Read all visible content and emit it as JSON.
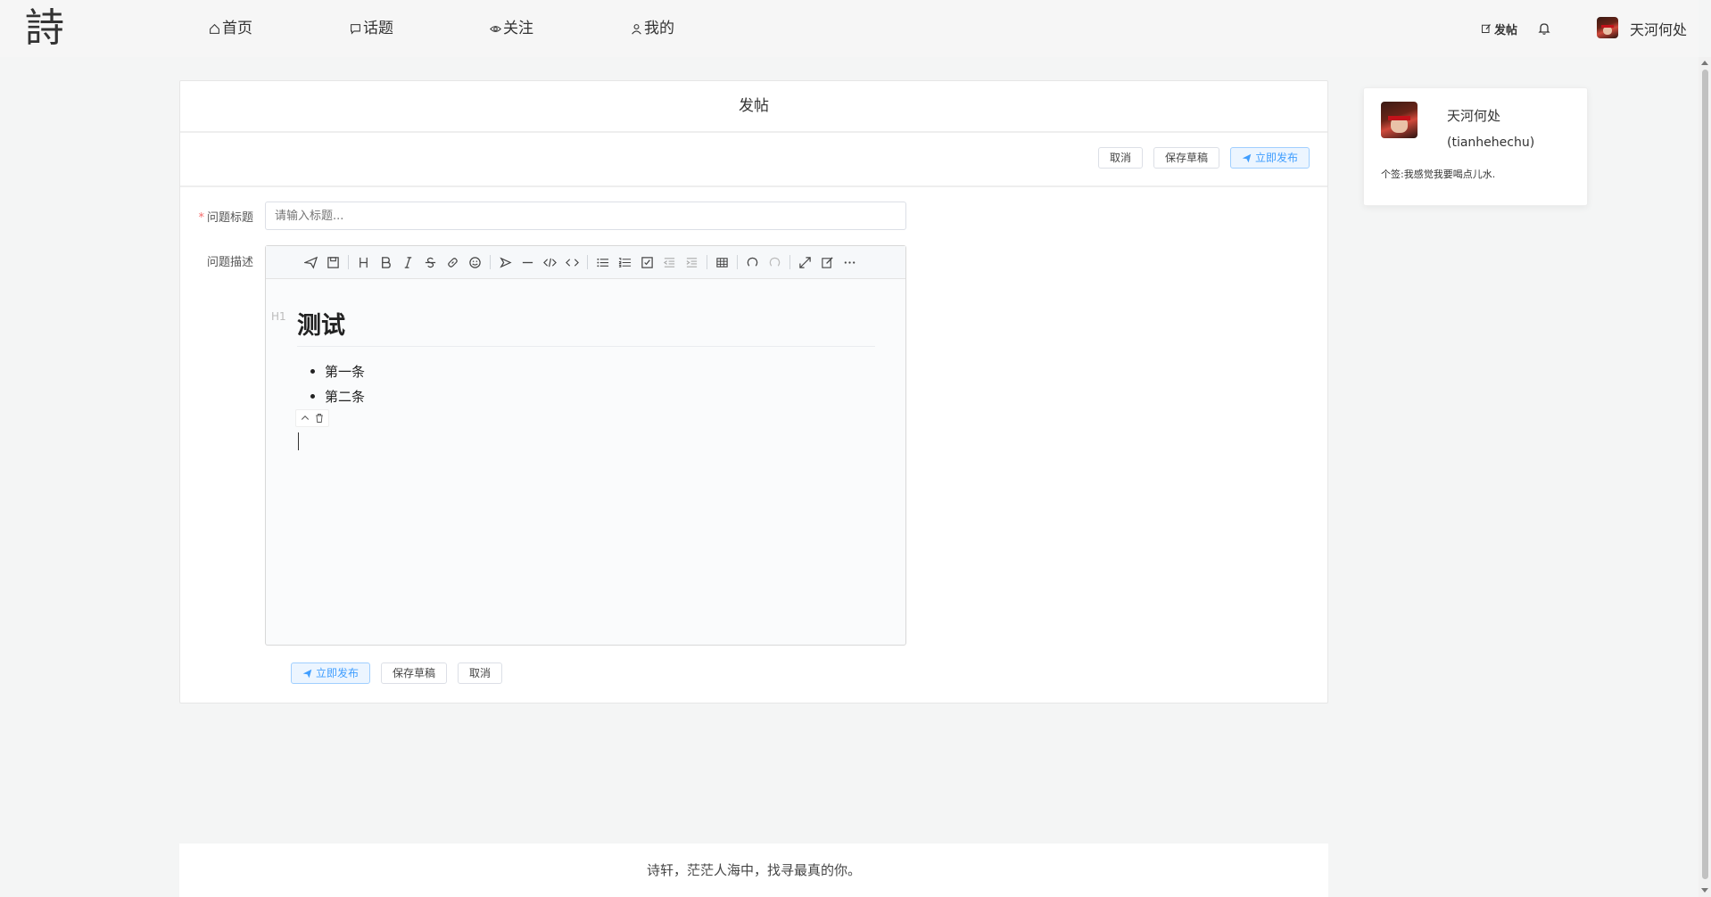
{
  "nav": {
    "logo": "詩",
    "items": [
      {
        "label": "首页",
        "icon": "home-icon"
      },
      {
        "label": "话题",
        "icon": "chat-icon"
      },
      {
        "label": "关注",
        "icon": "eye-icon"
      },
      {
        "label": "我的",
        "icon": "user-icon"
      }
    ],
    "post_label": "发帖",
    "username": "天河何处"
  },
  "panel": {
    "title": "发帖",
    "cancel": "取消",
    "save_draft": "保存草稿",
    "publish": "立即发布"
  },
  "form": {
    "title_label": "问题标题",
    "title_placeholder": "请输入标题...",
    "desc_label": "问题描述"
  },
  "editor": {
    "heading_marker": "H1",
    "heading": "测试",
    "list_items": [
      "第一条",
      "第二条"
    ]
  },
  "card": {
    "name": "天河何处",
    "handle": "(tianhehechu)",
    "signature": "个签:我感觉我要喝点儿水."
  },
  "footer": {
    "text": "诗轩，茫茫人海中，找寻最真的你。"
  },
  "colors": {
    "accent": "#409eff",
    "required": "#f56c6c"
  }
}
